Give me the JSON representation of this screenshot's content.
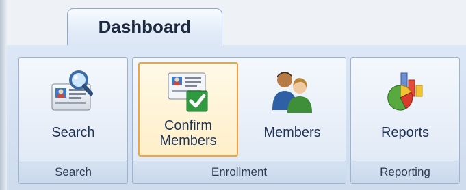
{
  "tabs": [
    {
      "label": "Dashboard",
      "active": true
    }
  ],
  "groups": [
    {
      "label": "Search",
      "buttons": [
        {
          "label": "Search",
          "icon": "search-card-icon"
        }
      ]
    },
    {
      "label": "Enrollment",
      "buttons": [
        {
          "label_line1": "Confirm",
          "label_line2": "Members",
          "icon": "confirm-card-icon",
          "selected": true
        },
        {
          "label": "Members",
          "icon": "members-icon"
        }
      ]
    },
    {
      "label": "Reporting",
      "buttons": [
        {
          "label": "Reports",
          "icon": "reports-chart-icon"
        }
      ]
    }
  ],
  "colors": {
    "selected_border": "#f2a33a",
    "accent_blue": "#3d79c9",
    "check_green": "#2f9a3f"
  }
}
